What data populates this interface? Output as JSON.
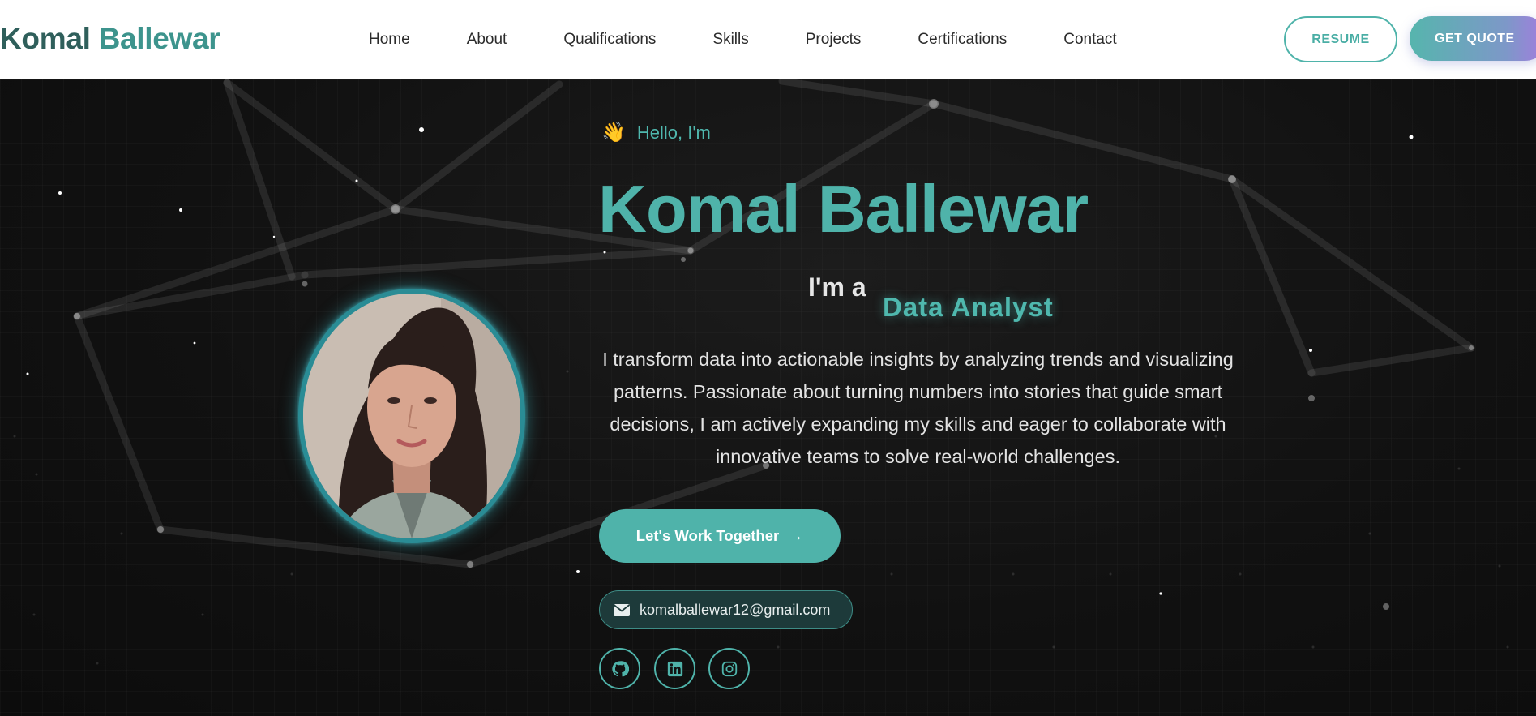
{
  "brand": {
    "first": "Komal",
    "last": "Ballewar"
  },
  "nav": {
    "links": [
      "Home",
      "About",
      "Qualifications",
      "Skills",
      "Projects",
      "Certifications",
      "Contact"
    ],
    "resume_label": "RESUME",
    "quote_label": "GET QUOTE"
  },
  "hero": {
    "greeting": "Hello, I'm",
    "greeting_icon": "👋",
    "name": "Komal Ballewar",
    "role_prefix": "I'm a",
    "role": "Data Analyst",
    "bio": "I transform data into actionable insights by analyzing trends and visualizing patterns. Passionate about turning numbers into stories that guide smart decisions, I am actively expanding my skills and eager to collaborate with innovative teams to solve real-world challenges.",
    "cta_label": "Let's Work Together",
    "email": "komalballewar12@gmail.com",
    "socials": [
      "github-icon",
      "linkedin-icon",
      "instagram-icon"
    ]
  },
  "colors": {
    "accent": "#4fb3aa",
    "brand_dark": "#2f5f5b",
    "background": "#111111"
  }
}
